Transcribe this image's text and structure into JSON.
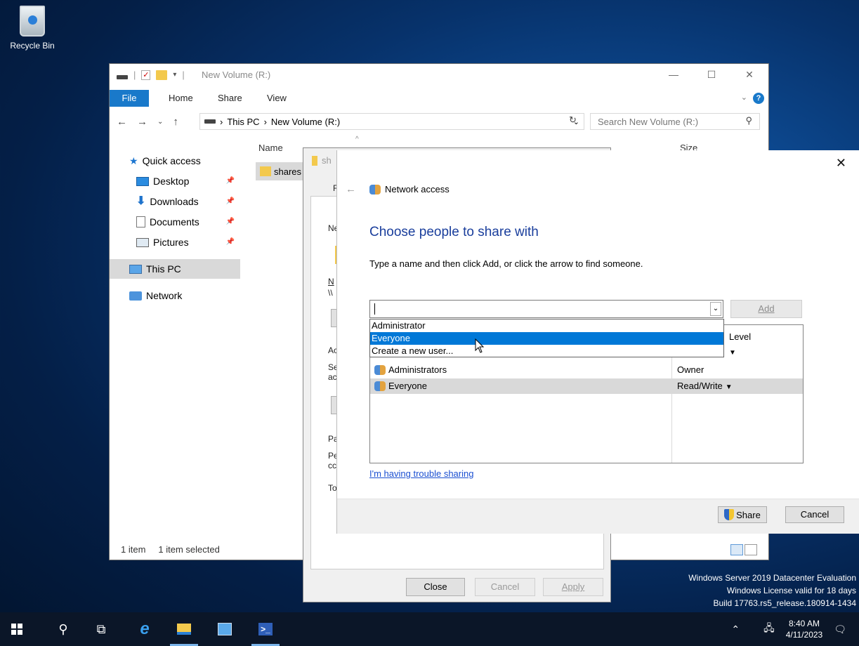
{
  "desktop": {
    "recycle_bin_label": "Recycle Bin"
  },
  "explorer": {
    "title": "New Volume (R:)",
    "ribbon_tabs": [
      "File",
      "Home",
      "Share",
      "View"
    ],
    "address": {
      "crumbs": [
        "This PC",
        "New Volume (R:)"
      ]
    },
    "search_placeholder": "Search New Volume (R:)",
    "nav": {
      "quick_access": "Quick access",
      "desktop": "Desktop",
      "downloads": "Downloads",
      "documents": "Documents",
      "pictures": "Pictures",
      "this_pc": "This PC",
      "network": "Network"
    },
    "columns": {
      "name": "Name",
      "size": "Size"
    },
    "files": [
      {
        "name": "shares"
      }
    ],
    "status": {
      "count": "1 item",
      "selection": "1 item selected"
    }
  },
  "properties": {
    "title_fragment": "sh",
    "buttons": {
      "close": "Close",
      "cancel": "Cancel",
      "apply": "Apply"
    },
    "fragments": [
      "F",
      "Ne",
      "N",
      "\\\\",
      "Ac",
      "Se",
      "ac",
      "Pa",
      "Pe",
      "cc",
      "To"
    ]
  },
  "network_access": {
    "window_title": "Network access",
    "heading": "Choose people to share with",
    "instruction": "Type a name and then click Add, or click the arrow to find someone.",
    "name_input_value": "",
    "add_button": "Add",
    "permission_level_header": "Level",
    "permissions": [
      {
        "name": "Administrators",
        "level": "Owner",
        "has_menu": false
      },
      {
        "name": "Everyone",
        "level": "Read/Write",
        "has_menu": true
      }
    ],
    "trouble_link": "I'm having trouble sharing",
    "share_button": "Share",
    "cancel_button": "Cancel",
    "dropdown_options": [
      "Administrator",
      "Everyone",
      "Create a new user..."
    ],
    "dropdown_highlighted": "Everyone"
  },
  "watermark": {
    "line1": "Windows Server 2019 Datacenter Evaluation",
    "line2": "Windows License valid for 18 days",
    "line3": "Build 17763.rs5_release.180914-1434"
  },
  "taskbar": {
    "time": "8:40 AM",
    "date": "4/11/2023",
    "items": [
      "start-icon",
      "search-icon",
      "task-view-icon",
      "internet-explorer-icon",
      "file-explorer-icon",
      "server-manager-icon",
      "powershell-icon"
    ]
  },
  "colors": {
    "accent": "#0078d7",
    "ribbon_file": "#1979ca",
    "heading_blue": "#1a3e9c",
    "link_blue": "#1a4fd1"
  }
}
